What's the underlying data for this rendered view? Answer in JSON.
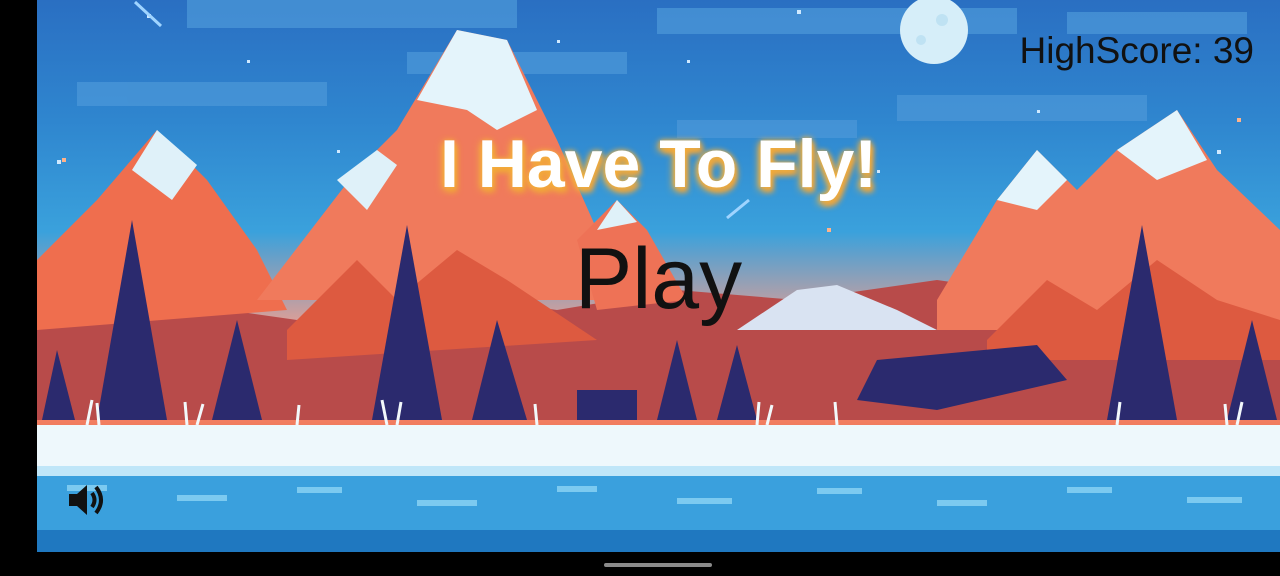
{
  "game": {
    "highscore_text": "HighScore: 39",
    "title": "I Have To Fly!",
    "play_label": "Play",
    "sound_icon": "volume-up-icon"
  },
  "colors": {
    "sky": "#2f86cf",
    "mountain": "#f07a5c",
    "snow": "#e6f4fb",
    "tree": "#2b2a6e",
    "water": "#3aa0dd",
    "title_glow": "#f6b13a",
    "text_dark": "#111111"
  }
}
